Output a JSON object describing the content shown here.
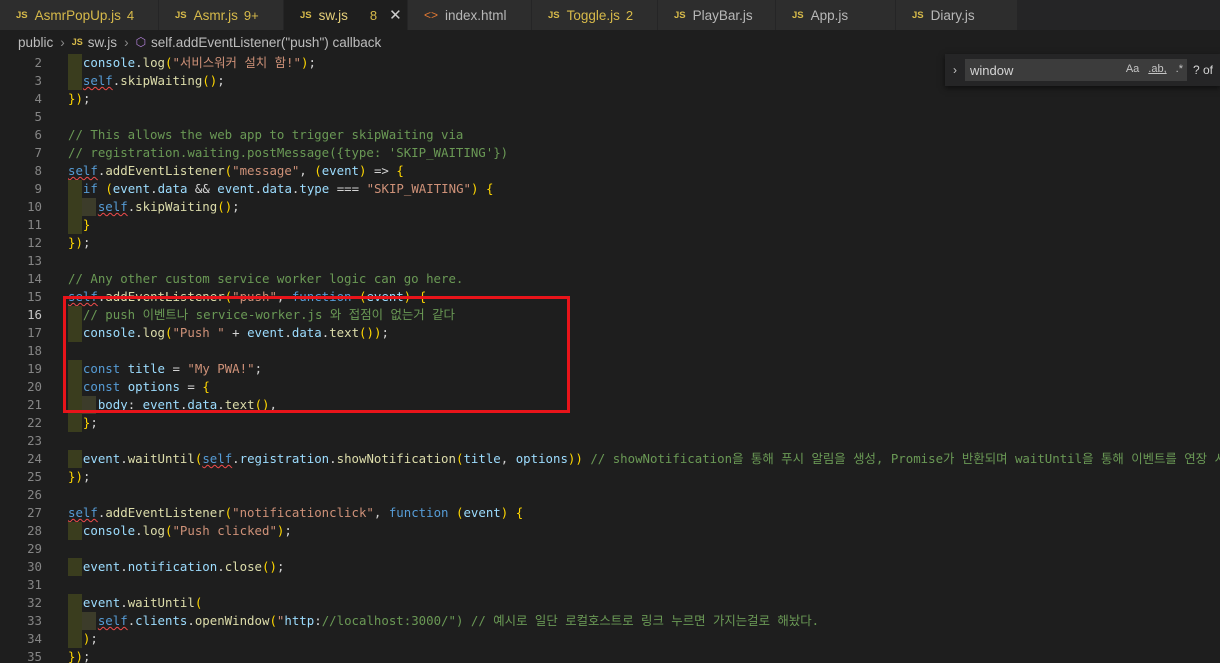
{
  "tabs": [
    {
      "icon": "JS",
      "name": "AsmrPopUp.js",
      "badge": "4",
      "active": false
    },
    {
      "icon": "JS",
      "name": "Asmr.js",
      "badge": "9+",
      "active": false
    },
    {
      "icon": "JS",
      "name": "sw.js",
      "badge": "8",
      "active": true
    },
    {
      "icon": "<>",
      "name": "index.html",
      "badge": "",
      "active": false
    },
    {
      "icon": "JS",
      "name": "Toggle.js",
      "badge": "2",
      "active": false
    },
    {
      "icon": "JS",
      "name": "PlayBar.js",
      "badge": "",
      "active": false
    },
    {
      "icon": "JS",
      "name": "App.js",
      "badge": "",
      "active": false
    },
    {
      "icon": "JS",
      "name": "Diary.js",
      "badge": "",
      "active": false
    }
  ],
  "breadcrumb": {
    "folder": "public",
    "file_icon": "JS",
    "file": "sw.js",
    "symbol": "self.addEventListener(\"push\") callback"
  },
  "find": {
    "query": "window",
    "match_case": "Aa",
    "whole_word": ".ab,",
    "regex": ".*",
    "result": "? of"
  },
  "editor": {
    "current_line": "16",
    "lines": [
      {
        "n": "2",
        "t": "  console.log(\"서비스워커 설치 함!\");"
      },
      {
        "n": "3",
        "t": "  self.skipWaiting();"
      },
      {
        "n": "4",
        "t": "});"
      },
      {
        "n": "5",
        "t": ""
      },
      {
        "n": "6",
        "t": "// This allows the web app to trigger skipWaiting via"
      },
      {
        "n": "7",
        "t": "// registration.waiting.postMessage({type: 'SKIP_WAITING'})"
      },
      {
        "n": "8",
        "t": "self.addEventListener(\"message\", (event) => {"
      },
      {
        "n": "9",
        "t": "  if (event.data && event.data.type === \"SKIP_WAITING\") {"
      },
      {
        "n": "10",
        "t": "    self.skipWaiting();"
      },
      {
        "n": "11",
        "t": "  }"
      },
      {
        "n": "12",
        "t": "});"
      },
      {
        "n": "13",
        "t": ""
      },
      {
        "n": "14",
        "t": "// Any other custom service worker logic can go here."
      },
      {
        "n": "15",
        "t": "self.addEventListener(\"push\", function (event) {"
      },
      {
        "n": "16",
        "t": "  // push 이벤트나 service-worker.js 와 접점이 없는거 같다"
      },
      {
        "n": "17",
        "t": "  console.log(\"Push \" + event.data.text());"
      },
      {
        "n": "18",
        "t": ""
      },
      {
        "n": "19",
        "t": "  const title = \"My PWA!\";"
      },
      {
        "n": "20",
        "t": "  const options = {"
      },
      {
        "n": "21",
        "t": "    body: event.data.text(),"
      },
      {
        "n": "22",
        "t": "  };"
      },
      {
        "n": "23",
        "t": ""
      },
      {
        "n": "24",
        "t": "  event.waitUntil(self.registration.showNotification(title, options)) // showNotification을 통해 푸시 알림을 생성, Promise가 반환되며 waitUntil을 통해 이벤트를 연장 시켜야함"
      },
      {
        "n": "25",
        "t": "});"
      },
      {
        "n": "26",
        "t": ""
      },
      {
        "n": "27",
        "t": "self.addEventListener(\"notificationclick\", function (event) {"
      },
      {
        "n": "28",
        "t": "  console.log(\"Push clicked\");"
      },
      {
        "n": "29",
        "t": ""
      },
      {
        "n": "30",
        "t": "  event.notification.close();"
      },
      {
        "n": "31",
        "t": ""
      },
      {
        "n": "32",
        "t": "  event.waitUntil("
      },
      {
        "n": "33",
        "t": "    self.clients.openWindow(\"http://localhost:3000/\") // 예시로 일단 로컬호스트로 링크 누르면 가지는걸로 해놨다."
      },
      {
        "n": "34",
        "t": "  );"
      },
      {
        "n": "35",
        "t": "});"
      }
    ]
  },
  "colors": {
    "keyword": "#569cd6",
    "function": "#dcdcaa",
    "string": "#ce9178",
    "comment": "#6a9955",
    "variable": "#9cdcfe",
    "highlight_box": "#e8141a",
    "background": "#1e1e1e"
  }
}
